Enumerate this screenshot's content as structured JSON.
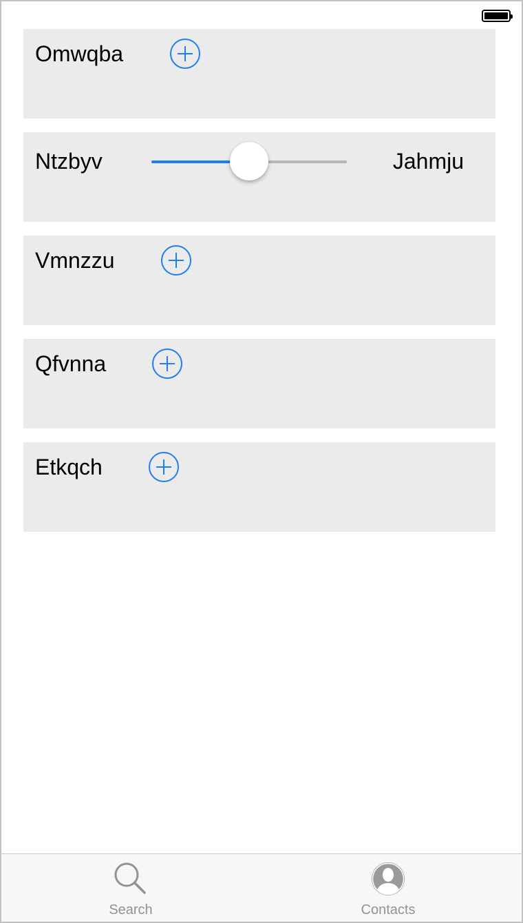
{
  "status_bar": {
    "battery_icon": "battery-full-icon"
  },
  "cards": [
    {
      "label": "Omwqba",
      "action_icon": "plus-circle-icon"
    },
    {
      "label": "Ntzbyv",
      "slider_right_label": "Jahmju",
      "slider_value_fraction": 0.5
    },
    {
      "label": "Vmnzzu",
      "action_icon": "plus-circle-icon"
    },
    {
      "label": "Qfvnna",
      "action_icon": "plus-circle-icon"
    },
    {
      "label": "Etkqch",
      "action_icon": "plus-circle-icon"
    }
  ],
  "tab_bar": {
    "tabs": [
      {
        "label": "Search",
        "icon": "search-icon"
      },
      {
        "label": "Contacts",
        "icon": "contact-avatar-icon"
      }
    ]
  },
  "colors": {
    "accent": "#1e7ef0",
    "card_background": "#ebebeb",
    "tab_label": "#929292"
  }
}
